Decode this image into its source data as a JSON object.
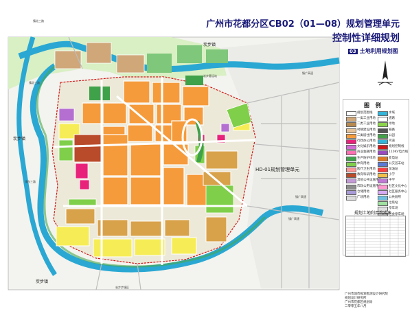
{
  "header": {
    "title_line1": "广州市花都分区CB02（01—08）规划管理单元",
    "title_line2": "控制性详细规划",
    "sheet_number": "03",
    "sheet_title": "土地利用规划图"
  },
  "map": {
    "labels": {
      "town_top_right": "炭步镇",
      "town_left": "炭步镇",
      "town_bottom_left": "炭步镇",
      "unit_label": "HD-01规划管理单元",
      "road_top_left": "镇北三路",
      "road_left_a": "镇北三路",
      "road_left_b": "镇东三路",
      "road_bottom_a": "镇广高速",
      "road_bottom_b": "镇广高速",
      "road_top_mid": "镇广高速",
      "road_top_place": "炭步客运站",
      "road_bottom_place": "炭步步镇区"
    }
  },
  "legend": {
    "title": "图 例",
    "colors": {
      "residential": "#f59b3c",
      "residential_light": "#fad27a",
      "commercial": "#e8217a",
      "public": "#c07ad6",
      "school": "#b97a2e",
      "green": "#8cd54b",
      "green_dark": "#44a14a",
      "industrial": "#c9a06e",
      "yellow": "#f1f04a",
      "water": "#33b5d9",
      "road": "#ffffff"
    },
    "left_items": [
      "规划范围线",
      "一类工业用地",
      "二类工业用地",
      "村镇建设用地",
      "二类居住用地",
      "行政办公用地",
      "文化娱乐用地",
      "商业金融用地",
      "生产防护绿地",
      "体育用地",
      "医疗卫生用地",
      "教育科研用地",
      "其他公共设施用地",
      "市政公用设施用地",
      "仓储用地",
      "广场用地"
    ],
    "right_items": [
      "水域",
      "道路",
      "绿地",
      "铁路",
      "公园",
      "河道",
      "规划控制线",
      "110KV电力线",
      "变电站",
      "公交首末站",
      "加油站",
      "小学",
      "中学",
      "社区文化中心",
      "社区服务中心",
      "公共厕所",
      "垃圾站",
      "停车场",
      "社会停车场"
    ]
  },
  "table": {
    "title": "规划土地利用构成表"
  },
  "footer": {
    "line1": "广州市城市规划勘测设计研究院",
    "line2": "规划设计研究所",
    "line3": "广州市花都区规划局",
    "line4": "二零零五年八月"
  }
}
